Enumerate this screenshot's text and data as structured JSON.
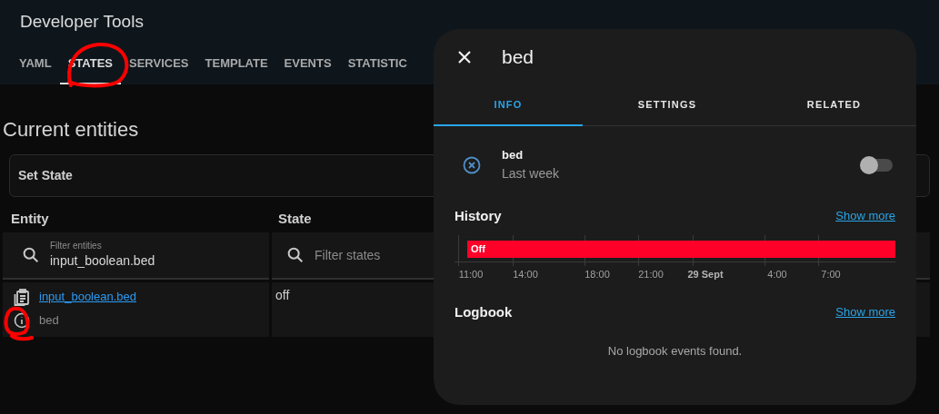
{
  "header": {
    "title": "Developer Tools"
  },
  "tabs": [
    {
      "label": "YAML",
      "selected": false
    },
    {
      "label": "STATES",
      "selected": true
    },
    {
      "label": "SERVICES",
      "selected": false
    },
    {
      "label": "TEMPLATE",
      "selected": false
    },
    {
      "label": "EVENTS",
      "selected": false
    },
    {
      "label": "STATISTIC",
      "selected": false
    }
  ],
  "section_title": "Current entities",
  "set_state": {
    "title": "Set State"
  },
  "table": {
    "columns": [
      "Entity",
      "State"
    ],
    "filters": [
      {
        "label": "Filter entities",
        "value": "input_boolean.bed"
      },
      {
        "placeholder": "Filter states"
      }
    ],
    "rows": [
      {
        "entity_id": "input_boolean.bed",
        "name": "bed",
        "state": "off"
      }
    ]
  },
  "dialog": {
    "title": "bed",
    "tabs": [
      {
        "label": "INFO",
        "selected": true
      },
      {
        "label": "SETTINGS",
        "selected": false
      },
      {
        "label": "RELATED",
        "selected": false
      }
    ],
    "entity": {
      "name": "bed",
      "changed": "Last week",
      "on": false
    },
    "history": {
      "title": "History",
      "link": "Show more",
      "bar_label": "Off",
      "ticks": [
        {
          "label": "11:00",
          "bold": false
        },
        {
          "label": "14:00",
          "bold": false
        },
        {
          "label": "18:00",
          "bold": false
        },
        {
          "label": "21:00",
          "bold": false
        },
        {
          "label": "29 Sept",
          "bold": true
        },
        {
          "label": "4:00",
          "bold": false
        },
        {
          "label": "7:00",
          "bold": false
        }
      ]
    },
    "logbook": {
      "title": "Logbook",
      "link": "Show more",
      "empty": "No logbook events found."
    }
  }
}
